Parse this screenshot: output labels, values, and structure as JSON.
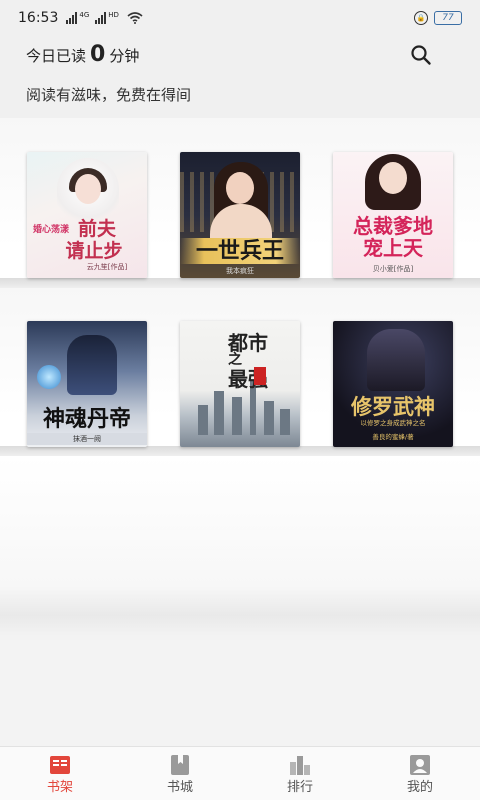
{
  "status_bar": {
    "time": "16:53",
    "signal1_label": "4G",
    "signal2_label": "HD",
    "battery": "77"
  },
  "header": {
    "read_prefix": "今日已读",
    "read_minutes": "0",
    "read_suffix": "分钟",
    "slogan": "阅读有滋味，免费在得间"
  },
  "books": [
    {
      "title": "前夫请止步",
      "cover_line1": "前夫",
      "cover_line2": "请止步",
      "cover_small": "婚心荡漾",
      "cover_author": "云九笙[作品]"
    },
    {
      "title": "一世兵王",
      "cover_line1": "一世兵王",
      "cover_author": "我本疯狂"
    },
    {
      "title": "总裁爹地宠上天",
      "cover_line1": "总裁爹地",
      "cover_line2": "宠上天",
      "cover_author": "贝小爱[作品]"
    },
    {
      "title": "神魂丹帝",
      "cover_line1": "神魂丹帝",
      "cover_author": "抹酒一阙"
    },
    {
      "title": "都市之最强",
      "cover_line1": "都市",
      "cover_line2": "之",
      "cover_line3": "最强"
    },
    {
      "title": "修罗武神",
      "cover_line1": "修罗武神",
      "cover_tagline": "以修罗之身成武神之名",
      "cover_author": "善良的蜜蜂/著"
    }
  ],
  "nav": {
    "items": [
      {
        "label": "书架",
        "icon": "bookshelf-icon",
        "active": true
      },
      {
        "label": "书城",
        "icon": "bookstore-icon",
        "active": false
      },
      {
        "label": "排行",
        "icon": "ranking-icon",
        "active": false
      },
      {
        "label": "我的",
        "icon": "profile-icon",
        "active": false
      }
    ]
  },
  "colors": {
    "accent": "#e2463b",
    "battery": "#3a6ea5"
  }
}
